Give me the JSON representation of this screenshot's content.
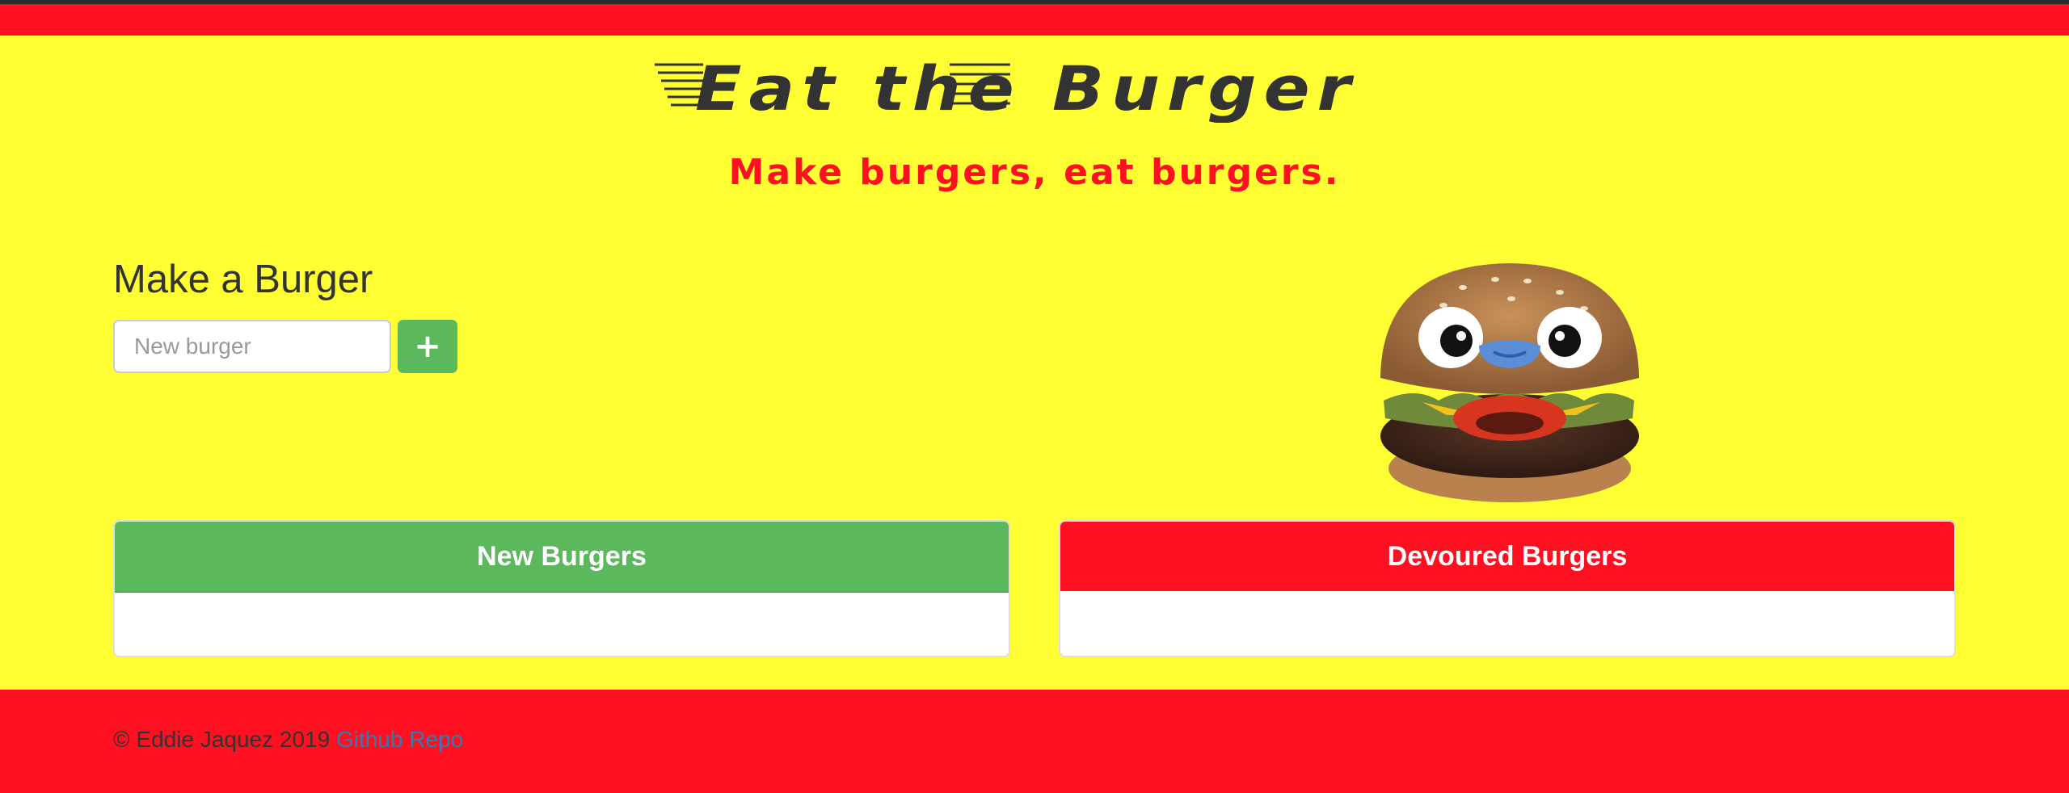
{
  "header": {
    "logo_text": "Eat the Burger",
    "tagline": "Make burgers, eat burgers."
  },
  "form": {
    "title": "Make a Burger",
    "input_placeholder": "New burger",
    "input_value": "",
    "add_button_label": "+",
    "add_button_icon": "plus-icon"
  },
  "panels": {
    "new_title": "New Burgers",
    "new_items": [],
    "devoured_title": "Devoured Burgers",
    "devoured_items": []
  },
  "footer": {
    "copyright": "© Eddie Jaquez 2019",
    "link_label": "Github Repo"
  },
  "colors": {
    "background": "#ffff33",
    "brand_red": "#ff1020",
    "success_green": "#5cb85c",
    "link_blue": "#337ab7"
  }
}
